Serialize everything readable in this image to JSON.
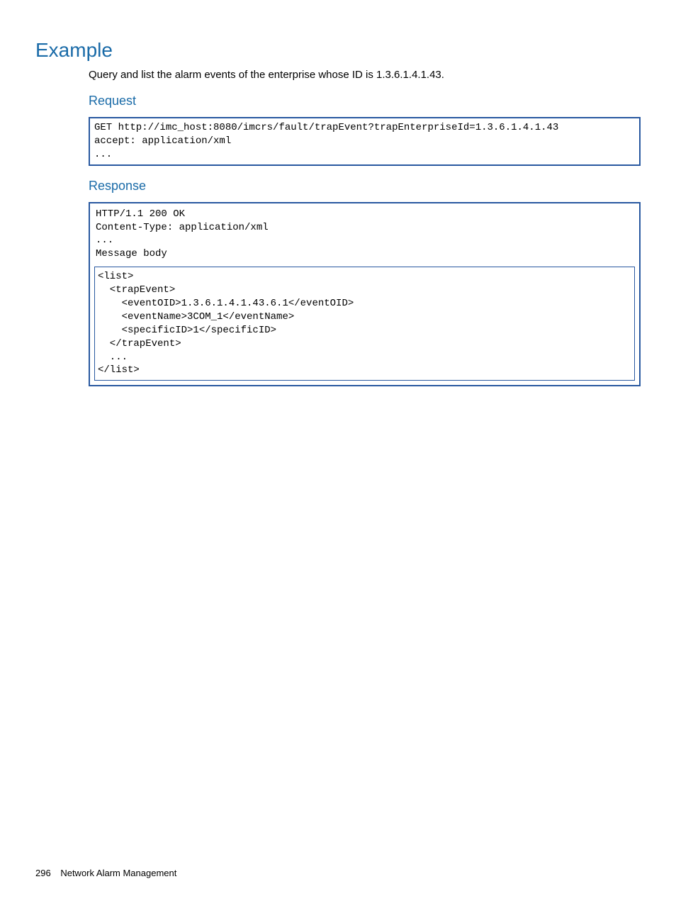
{
  "headings": {
    "example": "Example",
    "request": "Request",
    "response": "Response"
  },
  "body_text": "Query and list the alarm events of the enterprise whose ID is 1.3.6.1.4.1.43.",
  "request_code": "GET http://imc_host:8080/imcrs/fault/trapEvent?trapEnterpriseId=1.3.6.1.4.1.43\naccept: application/xml\n...",
  "response_headers": "HTTP/1.1 200 OK\nContent-Type: application/xml\n...\nMessage body",
  "response_body": "<list>\n  <trapEvent>\n    <eventOID>1.3.6.1.4.1.43.6.1</eventOID>\n    <eventName>3COM_1</eventName>\n    <specificID>1</specificID>\n  </trapEvent>\n  ...\n</list>",
  "footer": {
    "page_number": "296",
    "section": "Network Alarm Management"
  }
}
